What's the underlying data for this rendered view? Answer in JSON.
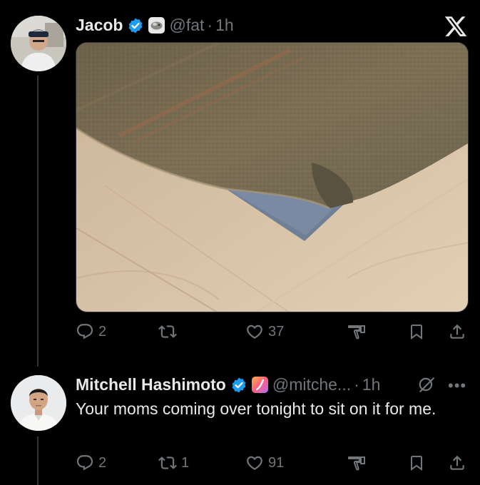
{
  "tweet1": {
    "name": "Jacob",
    "handle": "@fat",
    "time": "1h",
    "media_alt": "Corner of a woven rug flipped up on a light wood floor, showing blue rug pad underneath",
    "stats": {
      "replies": "2",
      "retweets": "",
      "likes": "37"
    }
  },
  "tweet2": {
    "name": "Mitchell Hashimoto",
    "handle": "@mitche...",
    "time": "1h",
    "text": "Your moms coming over tonight to sit on it for me.",
    "stats": {
      "replies": "2",
      "retweets": "1",
      "likes": "91"
    }
  },
  "icons": {
    "verified": "verified-badge-icon",
    "platform": "x-logo-icon",
    "reply": "reply-icon",
    "retweet": "retweet-icon",
    "like": "heart-icon",
    "stats": "analytics-icon",
    "bookmark": "bookmark-icon",
    "share": "share-icon",
    "grok": "grok-icon",
    "more": "more-icon"
  },
  "colors": {
    "background": "#000000",
    "text": "#e7e9ea",
    "muted": "#71767b",
    "verified": "#1d9bf0",
    "thread": "#333639"
  }
}
